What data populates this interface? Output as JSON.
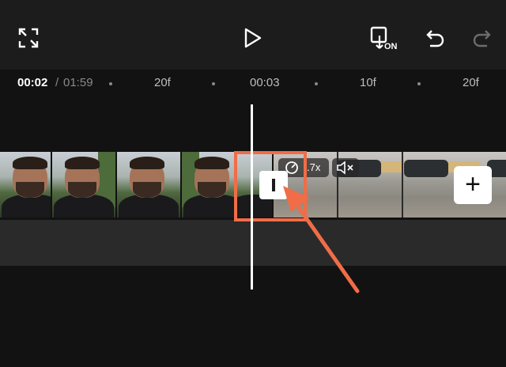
{
  "toolbar": {
    "fullscreen_icon": "fullscreen-expand-icon",
    "play_icon": "play-icon",
    "preview_icon": "preview-on-icon",
    "preview_badge": "ON",
    "undo_icon": "undo-icon",
    "redo_icon": "redo-icon"
  },
  "timecode": {
    "current": "00:02",
    "separator": "/",
    "total": "01:59"
  },
  "ruler": {
    "marks": [
      "20f",
      "00:03",
      "10f",
      "20f"
    ]
  },
  "timeline": {
    "speed_icon": "speed-gauge-icon",
    "speed_label": ".7x",
    "mute_icon": "speaker-muted-icon",
    "transition_icon": "transition-icon",
    "add_label": "+",
    "highlight_color": "#f06d47",
    "arrow_color": "#f06d47"
  }
}
